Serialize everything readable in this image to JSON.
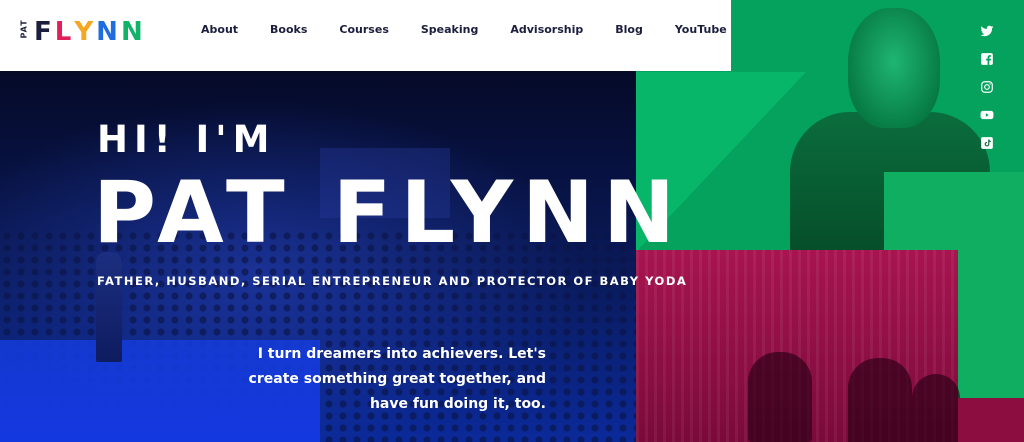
{
  "brand": {
    "logo_small": "PAT",
    "logo_letters": [
      {
        "char": "F",
        "color": "#1b1e3d"
      },
      {
        "char": "L",
        "color": "#e01e5a"
      },
      {
        "char": "Y",
        "color": "#f5a623"
      },
      {
        "char": "N",
        "color": "#1f6ee0"
      },
      {
        "char": "N",
        "color": "#11b36b"
      }
    ]
  },
  "nav": {
    "items": [
      "About",
      "Books",
      "Courses",
      "Speaking",
      "Advisorship",
      "Blog",
      "YouTube"
    ]
  },
  "social": {
    "icons": [
      "twitter-icon",
      "facebook-icon",
      "instagram-icon",
      "youtube-icon",
      "tiktok-icon"
    ]
  },
  "hero": {
    "greeting": "HI! I'M",
    "name": "PAT FLYNN",
    "tagline": "FATHER, HUSBAND, SERIAL ENTREPRENEUR AND PROTECTOR OF BABY YODA",
    "pitch_lines": [
      "I turn dreamers into achievers. Let's",
      "create something great together, and",
      "have fun doing it, too."
    ]
  },
  "colors": {
    "navy": "#1b1e3d",
    "green": "#04a25d",
    "crimson": "#a81450",
    "blue": "#1438e0"
  }
}
